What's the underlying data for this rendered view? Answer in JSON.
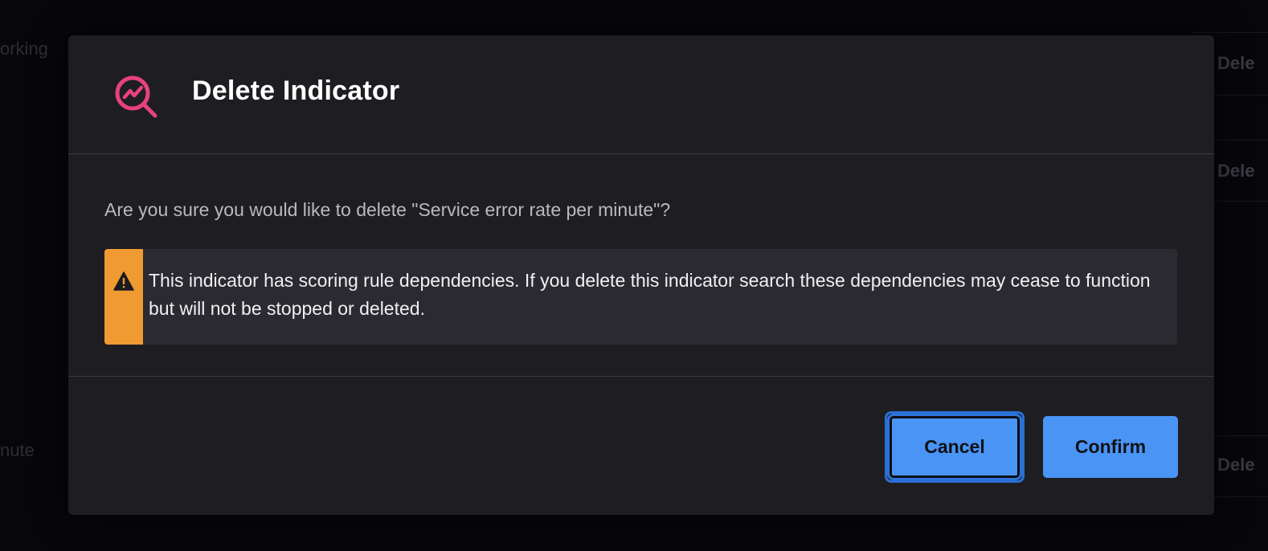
{
  "background": {
    "left_fragments": [
      "orking",
      "nute"
    ],
    "right_fragments": [
      "Dele",
      "Dele",
      "Dele"
    ]
  },
  "dialog": {
    "icon": "magnifier-trend-icon",
    "title": "Delete Indicator",
    "question": "Are you sure you would like to delete \"Service error rate per minute\"?",
    "warning": {
      "icon": "warning-triangle-icon",
      "text": "This indicator has scoring rule dependencies. If you delete this indicator search these dependencies may cease to function but will not be stopped or deleted."
    },
    "buttons": {
      "cancel_label": "Cancel",
      "confirm_label": "Confirm"
    }
  },
  "colors": {
    "accent_icon": "#e8417f",
    "warning": "#f09a32",
    "primary_button": "#4a94f5",
    "dialog_bg": "#1e1e22"
  }
}
